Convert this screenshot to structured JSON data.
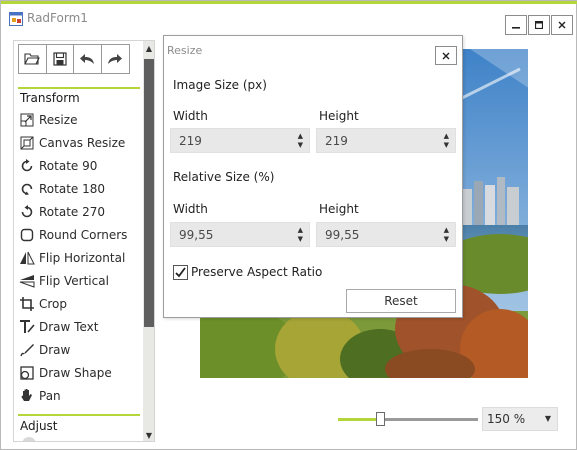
{
  "window": {
    "title": "RadForm1",
    "accent_color": "#b4d63b"
  },
  "toolbar": {
    "buttons": [
      {
        "icon": "open-folder-icon"
      },
      {
        "icon": "save-icon"
      },
      {
        "icon": "undo-icon"
      },
      {
        "icon": "redo-icon"
      }
    ]
  },
  "sidebar": {
    "transform_title": "Transform",
    "adjust_title": "Adjust",
    "items": [
      {
        "label": "Resize",
        "icon": "resize-icon"
      },
      {
        "label": "Canvas Resize",
        "icon": "canvas-resize-icon"
      },
      {
        "label": "Rotate 90",
        "icon": "rotate-90-icon"
      },
      {
        "label": "Rotate 180",
        "icon": "rotate-180-icon"
      },
      {
        "label": "Rotate 270",
        "icon": "rotate-270-icon"
      },
      {
        "label": "Round Corners",
        "icon": "round-corners-icon"
      },
      {
        "label": "Flip Horizontal",
        "icon": "flip-horizontal-icon"
      },
      {
        "label": "Flip Vertical",
        "icon": "flip-vertical-icon"
      },
      {
        "label": "Crop",
        "icon": "crop-icon"
      },
      {
        "label": "Draw Text",
        "icon": "draw-text-icon"
      },
      {
        "label": "Draw",
        "icon": "draw-icon"
      },
      {
        "label": "Draw Shape",
        "icon": "draw-shape-icon"
      },
      {
        "label": "Pan",
        "icon": "pan-icon"
      }
    ]
  },
  "dialog": {
    "title": "Resize",
    "image_size_label": "Image Size (px)",
    "relative_size_label": "Relative Size (%)",
    "width_label": "Width",
    "height_label": "Height",
    "pixel_width": "219",
    "pixel_height": "219",
    "relative_width": "99,55",
    "relative_height": "99,55",
    "preserve_label": "Preserve Aspect Ratio",
    "preserve_checked": true,
    "reset_label": "Reset"
  },
  "zoom": {
    "value": "150 %",
    "slider_fraction": 0.3
  }
}
